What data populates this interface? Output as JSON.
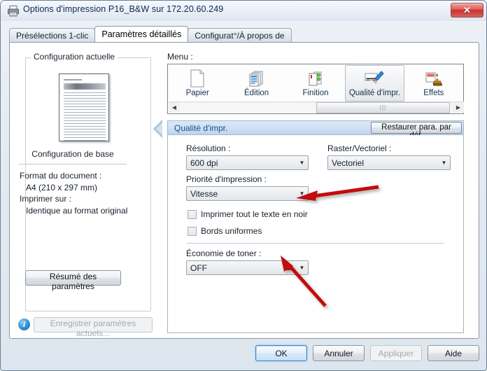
{
  "window": {
    "title": "Options d'impression P16_B&W sur 172.20.60.249",
    "title_icon": "printer-icon",
    "close_label": "✕"
  },
  "tabs": [
    {
      "label": "Présélections 1-clic",
      "active": false
    },
    {
      "label": "Paramètres détaillés",
      "active": true
    },
    {
      "label": "Configurat°/À propos de",
      "active": false
    }
  ],
  "left_panel": {
    "group_legend": "Configuration actuelle",
    "preview_name": "document-preview-thumbnail",
    "base_config_label": "Configuration de base",
    "info": {
      "doc_format_label": "Format du document :",
      "doc_format_value": "A4 (210 x 297 mm)",
      "print_on_label": "Imprimer sur :",
      "print_on_value": "Identique au format original"
    },
    "summary_button": "Résumé des paramètres",
    "save_button": "Enregistrer paramètres actuels...",
    "save_button_disabled": true,
    "info_icon_glyph": "i"
  },
  "right_panel": {
    "menu_label": "Menu :",
    "toolbar": [
      {
        "label": "Papier",
        "icon": "blank-page-icon",
        "active": false
      },
      {
        "label": "Édition",
        "icon": "pages-stack-icon",
        "active": false
      },
      {
        "label": "Finition",
        "icon": "finishing-pages-icon",
        "active": false
      },
      {
        "label": "Qualité d'impr.",
        "icon": "paintbrush-icon",
        "active": true
      },
      {
        "label": "Effets",
        "icon": "stamp-icon",
        "active": false
      }
    ],
    "scrollbar": {
      "left_arrow": "◀",
      "right_arrow": "▶",
      "grip": "|||"
    },
    "section": {
      "title": "Qualité d'impr.",
      "restore_button": "Restaurer para. par déf."
    },
    "fields": {
      "resolution_label": "Résolution :",
      "resolution_value": "600 dpi",
      "raster_label": "Raster/Vectoriel :",
      "raster_value": "Vectoriel",
      "priority_label": "Priorité d'impression :",
      "priority_value": "Vitesse",
      "toner_label": "Économie de toner :",
      "toner_value": "OFF"
    },
    "checkboxes": [
      {
        "label": "Imprimer tout le texte en noir",
        "checked": false
      },
      {
        "label": "Bords uniformes",
        "checked": false
      }
    ]
  },
  "footer": {
    "buttons": [
      {
        "label": "OK",
        "state": "focused"
      },
      {
        "label": "Annuler",
        "state": "normal"
      },
      {
        "label": "Appliquer",
        "state": "disabled"
      },
      {
        "label": "Aide",
        "state": "normal"
      }
    ]
  },
  "annotations": {
    "arrow_color": "#c10d0d",
    "arrow_1_name": "red-arrow-pointing-to-print-all-text-in-black",
    "arrow_2_name": "red-arrow-pointing-to-toner-save-dropdown"
  },
  "colors": {
    "accent_blue": "#1c4f87",
    "close_red": "#c9332f",
    "annotation_red": "#c10d0d"
  }
}
